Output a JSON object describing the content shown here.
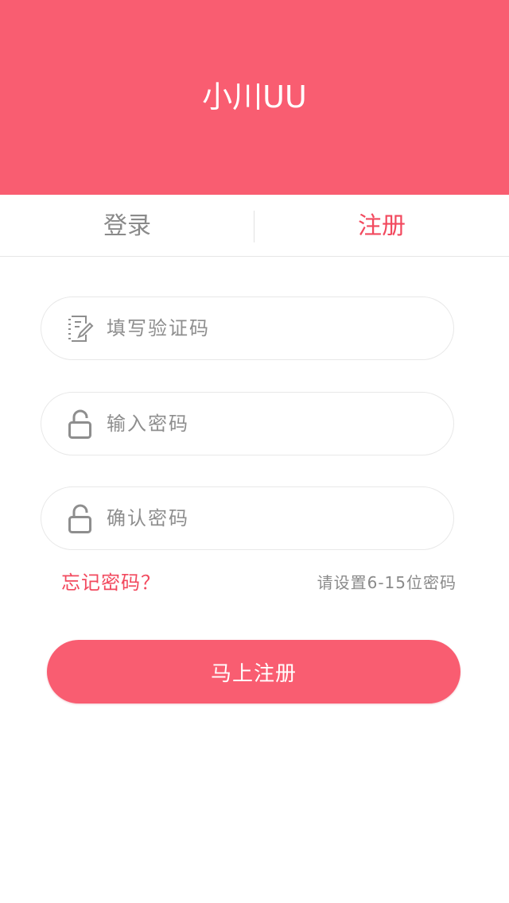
{
  "header": {
    "title": "小川UU"
  },
  "tabs": [
    {
      "label": "登录",
      "active": false
    },
    {
      "label": "注册",
      "active": true
    }
  ],
  "form": {
    "fields": [
      {
        "icon": "edit-icon",
        "placeholder": "填写验证码",
        "value": ""
      },
      {
        "icon": "lock-icon",
        "placeholder": "输入密码",
        "value": ""
      },
      {
        "icon": "lock-icon",
        "placeholder": "确认密码",
        "value": ""
      }
    ],
    "forgot_label": "忘记密码？",
    "hint": "请设置6-15位密码",
    "submit_label": "马上注册"
  },
  "colors": {
    "accent": "#f95d71",
    "accent_text": "#f2495e",
    "muted_text": "#8a8a8a",
    "icon_gray": "#8e8e8e"
  }
}
